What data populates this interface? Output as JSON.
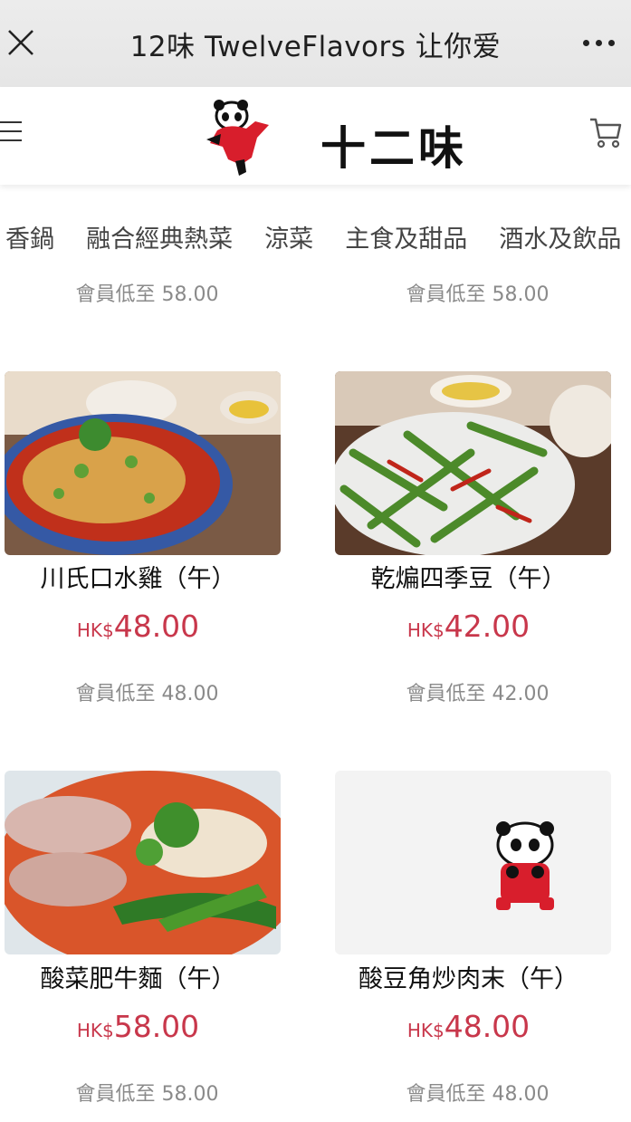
{
  "topbar": {
    "title": "12味 TwelveFlavors 让你爱",
    "close_icon": "close-icon",
    "more_icon": "more-icon"
  },
  "header": {
    "menu_icon": "hamburger-icon",
    "logo_text": "十二味",
    "cart_icon": "cart-icon"
  },
  "categories": [
    "香鍋",
    "融合經典熱菜",
    "涼菜",
    "主食及甜品",
    "酒水及飲品"
  ],
  "top_member_prices": [
    "會員低至 58.00",
    "會員低至 58.00"
  ],
  "products": [
    {
      "name": "川氏口水雞（午）",
      "currency": "HK$",
      "price": "48.00",
      "member": "會員低至 48.00",
      "image": "chicken-dish"
    },
    {
      "name": "乾煸四季豆（午）",
      "currency": "HK$",
      "price": "42.00",
      "member": "會員低至 42.00",
      "image": "green-beans-dish"
    },
    {
      "name": "酸菜肥牛麵（午）",
      "currency": "HK$",
      "price": "58.00",
      "member": "會員低至 58.00",
      "image": "beef-noodle-dish"
    },
    {
      "name": "酸豆角炒肉末（午）",
      "currency": "HK$",
      "price": "48.00",
      "member": "會員低至 48.00",
      "image": "panda-placeholder"
    }
  ],
  "colors": {
    "price": "#c8374b",
    "member": "#8a8a8a",
    "logo_red": "#d81e2c"
  }
}
